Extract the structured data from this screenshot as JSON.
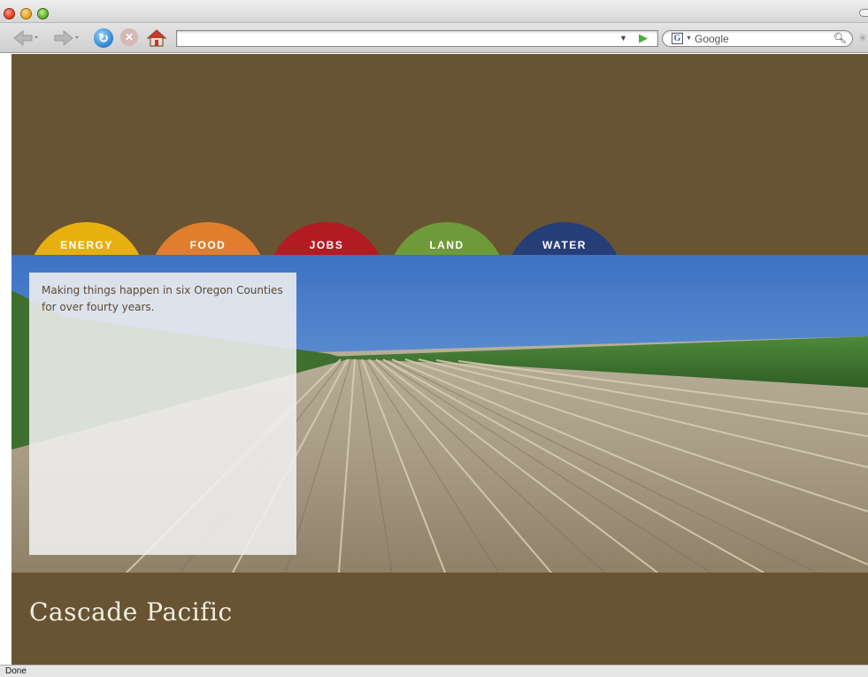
{
  "browser": {
    "url": "",
    "search_engine": "Google",
    "status": "Done",
    "icons": [
      "back-arrow-icon",
      "forward-arrow-icon",
      "reload-icon",
      "stop-icon",
      "home-icon",
      "search-icon"
    ]
  },
  "nav": {
    "tabs": [
      {
        "label": "ENERGY",
        "color": "#e8b00e"
      },
      {
        "label": "FOOD",
        "color": "#e07e2e"
      },
      {
        "label": "JOBS",
        "color": "#b31b23"
      },
      {
        "label": "LAND",
        "color": "#6f9a3a"
      },
      {
        "label": "WATER",
        "color": "#263e78"
      }
    ]
  },
  "hero": {
    "tagline": "Making things happen in six Oregon Counties for over fourty years."
  },
  "footer": {
    "site_title": "Cascade Pacific"
  },
  "colors": {
    "brown": "#685433",
    "overlay": "#f0f0f0"
  }
}
